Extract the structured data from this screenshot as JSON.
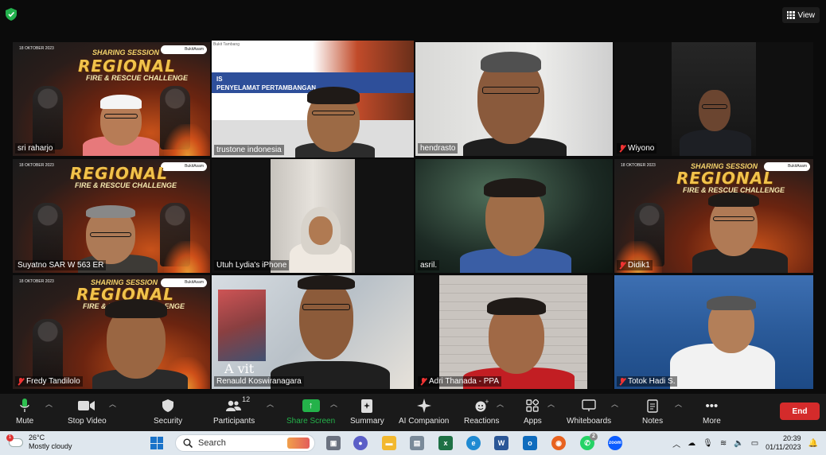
{
  "topbar": {
    "view_label": "View"
  },
  "tiles": [
    {
      "name": "sri raharjo",
      "muted": false
    },
    {
      "name": "trustone indonesia",
      "muted": false,
      "active": true
    },
    {
      "name": "hendrasto",
      "muted": false
    },
    {
      "name": "Wiyono",
      "muted": true
    },
    {
      "name": "Suyatno SAR W 563 ER",
      "muted": false
    },
    {
      "name": "Utuh Lydia's iPhone",
      "muted": false
    },
    {
      "name": "asril.",
      "muted": false
    },
    {
      "name": "Didik1",
      "muted": true
    },
    {
      "name": "Fredy Tandilolo",
      "muted": true
    },
    {
      "name": "Renauld Koswiranagara",
      "muted": false
    },
    {
      "name": "Adri Thanada - PPA",
      "muted": true
    },
    {
      "name": "Totok Hadi S.",
      "muted": true
    }
  ],
  "banner": {
    "date": "18 OKTOBER 2023",
    "subtitle": "SHARING SESSION",
    "title": "REGIONAL",
    "title2": "FIRE & RESCUE CHALLENGE",
    "logos": "BukitAsam"
  },
  "slide": {
    "line1": "IS",
    "line2": "PENYELAMAT PERTAMBANGAN",
    "corner": "Bukit Tambang"
  },
  "background_text": "A vit",
  "toolbar": {
    "mute": "Mute",
    "stop_video": "Stop Video",
    "security": "Security",
    "participants": "Participants",
    "participants_count": "12",
    "share_screen": "Share Screen",
    "summary": "Summary",
    "ai_companion": "AI Companion",
    "reactions": "Reactions",
    "apps": "Apps",
    "whiteboards": "Whiteboards",
    "notes": "Notes",
    "more": "More",
    "end": "End"
  },
  "taskbar": {
    "weather_temp": "26°C",
    "weather_desc": "Mostly cloudy",
    "weather_badge": "1",
    "search_placeholder": "Search",
    "whatsapp_badge": "2",
    "time": "20:39",
    "date": "01/11/2023"
  },
  "colors": {
    "active_border": "#e6d44a",
    "share_green": "#24b24a",
    "end_red": "#d42b2b",
    "muted_red": "#e33"
  }
}
